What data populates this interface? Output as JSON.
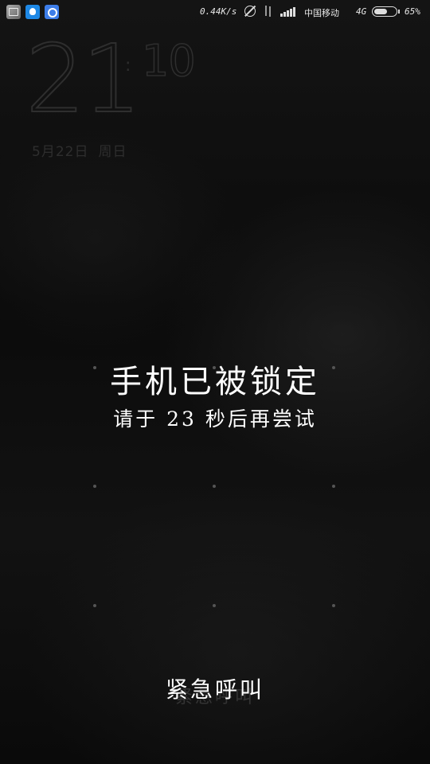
{
  "status_bar": {
    "net_speed": "0.44K/s",
    "carrier": "中国移动",
    "network_type": "4G",
    "battery_percent": "65%",
    "battery_level": 0.65,
    "icons": [
      "gallery-icon",
      "app-icon",
      "browser-icon",
      "alarm-off-icon",
      "data-arrows-icon",
      "signal-icon",
      "battery-icon"
    ]
  },
  "clock": {
    "hours": "21",
    "minutes": "10",
    "date": "5月22日",
    "weekday": "周日"
  },
  "lock_message": {
    "title": "手机已被锁定",
    "subtitle": "请于 23 秒后再尝试"
  },
  "emergency_call": {
    "label": "紧急呼叫"
  },
  "colors": {
    "background": "#000000",
    "clock": "#2e2e2e",
    "text": "#ffffff"
  }
}
